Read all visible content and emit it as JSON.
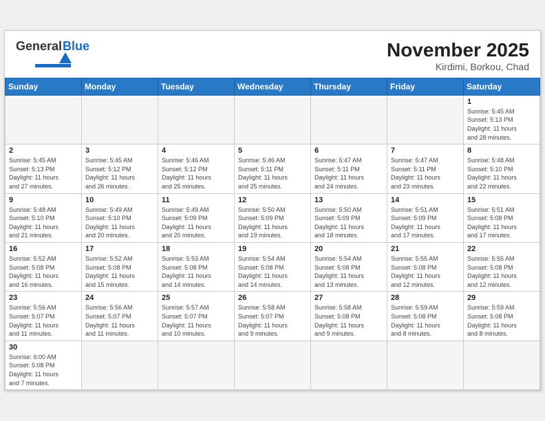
{
  "header": {
    "logo_general": "General",
    "logo_blue": "Blue",
    "month_year": "November 2025",
    "location": "Kirdimi, Borkou, Chad"
  },
  "days_of_week": [
    "Sunday",
    "Monday",
    "Tuesday",
    "Wednesday",
    "Thursday",
    "Friday",
    "Saturday"
  ],
  "weeks": [
    [
      {
        "day": "",
        "info": ""
      },
      {
        "day": "",
        "info": ""
      },
      {
        "day": "",
        "info": ""
      },
      {
        "day": "",
        "info": ""
      },
      {
        "day": "",
        "info": ""
      },
      {
        "day": "",
        "info": ""
      },
      {
        "day": "1",
        "info": "Sunrise: 5:45 AM\nSunset: 5:13 PM\nDaylight: 11 hours\nand 28 minutes."
      }
    ],
    [
      {
        "day": "2",
        "info": "Sunrise: 5:45 AM\nSunset: 5:13 PM\nDaylight: 11 hours\nand 27 minutes."
      },
      {
        "day": "3",
        "info": "Sunrise: 5:45 AM\nSunset: 5:12 PM\nDaylight: 11 hours\nand 26 minutes."
      },
      {
        "day": "4",
        "info": "Sunrise: 5:46 AM\nSunset: 5:12 PM\nDaylight: 11 hours\nand 25 minutes."
      },
      {
        "day": "5",
        "info": "Sunrise: 5:46 AM\nSunset: 5:11 PM\nDaylight: 11 hours\nand 25 minutes."
      },
      {
        "day": "6",
        "info": "Sunrise: 5:47 AM\nSunset: 5:11 PM\nDaylight: 11 hours\nand 24 minutes."
      },
      {
        "day": "7",
        "info": "Sunrise: 5:47 AM\nSunset: 5:11 PM\nDaylight: 11 hours\nand 23 minutes."
      },
      {
        "day": "8",
        "info": "Sunrise: 5:48 AM\nSunset: 5:10 PM\nDaylight: 11 hours\nand 22 minutes."
      }
    ],
    [
      {
        "day": "9",
        "info": "Sunrise: 5:48 AM\nSunset: 5:10 PM\nDaylight: 11 hours\nand 21 minutes."
      },
      {
        "day": "10",
        "info": "Sunrise: 5:49 AM\nSunset: 5:10 PM\nDaylight: 11 hours\nand 20 minutes."
      },
      {
        "day": "11",
        "info": "Sunrise: 5:49 AM\nSunset: 5:09 PM\nDaylight: 11 hours\nand 20 minutes."
      },
      {
        "day": "12",
        "info": "Sunrise: 5:50 AM\nSunset: 5:09 PM\nDaylight: 11 hours\nand 19 minutes."
      },
      {
        "day": "13",
        "info": "Sunrise: 5:50 AM\nSunset: 5:09 PM\nDaylight: 11 hours\nand 18 minutes."
      },
      {
        "day": "14",
        "info": "Sunrise: 5:51 AM\nSunset: 5:09 PM\nDaylight: 11 hours\nand 17 minutes."
      },
      {
        "day": "15",
        "info": "Sunrise: 5:51 AM\nSunset: 5:08 PM\nDaylight: 11 hours\nand 17 minutes."
      }
    ],
    [
      {
        "day": "16",
        "info": "Sunrise: 5:52 AM\nSunset: 5:08 PM\nDaylight: 11 hours\nand 16 minutes."
      },
      {
        "day": "17",
        "info": "Sunrise: 5:52 AM\nSunset: 5:08 PM\nDaylight: 11 hours\nand 15 minutes."
      },
      {
        "day": "18",
        "info": "Sunrise: 5:53 AM\nSunset: 5:08 PM\nDaylight: 11 hours\nand 14 minutes."
      },
      {
        "day": "19",
        "info": "Sunrise: 5:54 AM\nSunset: 5:08 PM\nDaylight: 11 hours\nand 14 minutes."
      },
      {
        "day": "20",
        "info": "Sunrise: 5:54 AM\nSunset: 5:08 PM\nDaylight: 11 hours\nand 13 minutes."
      },
      {
        "day": "21",
        "info": "Sunrise: 5:55 AM\nSunset: 5:08 PM\nDaylight: 11 hours\nand 12 minutes."
      },
      {
        "day": "22",
        "info": "Sunrise: 5:55 AM\nSunset: 5:08 PM\nDaylight: 11 hours\nand 12 minutes."
      }
    ],
    [
      {
        "day": "23",
        "info": "Sunrise: 5:56 AM\nSunset: 5:07 PM\nDaylight: 11 hours\nand 11 minutes."
      },
      {
        "day": "24",
        "info": "Sunrise: 5:56 AM\nSunset: 5:07 PM\nDaylight: 11 hours\nand 11 minutes."
      },
      {
        "day": "25",
        "info": "Sunrise: 5:57 AM\nSunset: 5:07 PM\nDaylight: 11 hours\nand 10 minutes."
      },
      {
        "day": "26",
        "info": "Sunrise: 5:58 AM\nSunset: 5:07 PM\nDaylight: 11 hours\nand 9 minutes."
      },
      {
        "day": "27",
        "info": "Sunrise: 5:58 AM\nSunset: 5:08 PM\nDaylight: 11 hours\nand 9 minutes."
      },
      {
        "day": "28",
        "info": "Sunrise: 5:59 AM\nSunset: 5:08 PM\nDaylight: 11 hours\nand 8 minutes."
      },
      {
        "day": "29",
        "info": "Sunrise: 5:59 AM\nSunset: 5:08 PM\nDaylight: 11 hours\nand 8 minutes."
      }
    ],
    [
      {
        "day": "30",
        "info": "Sunrise: 6:00 AM\nSunset: 5:08 PM\nDaylight: 11 hours\nand 7 minutes."
      },
      {
        "day": "",
        "info": ""
      },
      {
        "day": "",
        "info": ""
      },
      {
        "day": "",
        "info": ""
      },
      {
        "day": "",
        "info": ""
      },
      {
        "day": "",
        "info": ""
      },
      {
        "day": "",
        "info": ""
      }
    ]
  ]
}
